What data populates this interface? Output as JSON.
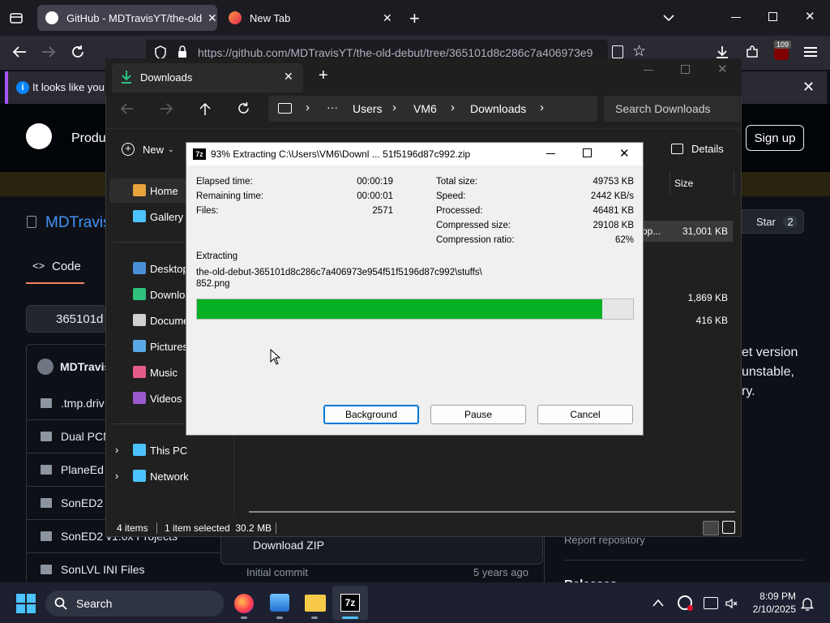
{
  "browser": {
    "tabs": [
      {
        "label": "GitHub - MDTravisYT/the-old-d",
        "active": true
      },
      {
        "label": "New Tab",
        "active": false
      }
    ],
    "url": "https://github.com/MDTravisYT/the-old-debut/tree/365101d8c286c7a406973e9",
    "notification_badge": "109",
    "notice_text": "It looks like you h"
  },
  "github": {
    "nav_label": "Produ",
    "signup_label": "Sign up",
    "repo_name": "MDTravis",
    "code_tab": "Code",
    "branch": "365101d",
    "star_label": "Star",
    "star_count": "2",
    "owner_label": "MDTravis",
    "files": [
      ".tmp.driv",
      "Dual PCM",
      "PlaneEd I",
      "SonED2 I",
      "SonED2 v1.0x Projects",
      "SonLVL INI Files"
    ],
    "download_zip": "Download ZIP",
    "commit_msg": "Initial commit",
    "commit_age": "5 years ago",
    "about_lines": [
      "et version",
      "unstable,",
      "ry."
    ],
    "report_repository": "Report repository",
    "releases": "Releases"
  },
  "explorer": {
    "title": "Downloads",
    "breadcrumb": [
      "Users",
      "VM6",
      "Downloads"
    ],
    "search_placeholder": "Search Downloads",
    "new_label": "New",
    "details_label": "Details",
    "size_header": "Size",
    "nav_items": [
      {
        "label": "Home",
        "icon": "home-icon"
      },
      {
        "label": "Gallery",
        "icon": "gallery-icon"
      },
      {
        "label": "Desktop",
        "icon": "desktop-icon"
      },
      {
        "label": "Downloa",
        "icon": "download-icon"
      },
      {
        "label": "Docume",
        "icon": "document-icon"
      },
      {
        "label": "Pictures",
        "icon": "pictures-icon"
      },
      {
        "label": "Music",
        "icon": "music-icon"
      },
      {
        "label": "Videos",
        "icon": "videos-icon"
      },
      {
        "label": "This PC",
        "icon": "pc-icon"
      },
      {
        "label": "Network",
        "icon": "network-icon"
      }
    ],
    "file_rows": [
      {
        "name": "pp...",
        "size": "31,001 KB"
      },
      {
        "name": "",
        "size": "1,869 KB"
      },
      {
        "name": "",
        "size": "416 KB"
      }
    ],
    "status_items": "4 items",
    "status_selected": "1 item selected  30.2 MB"
  },
  "sevenzip": {
    "title": "93% Extracting C:\\Users\\VM6\\Downl ... 51f5196d87c992.zip",
    "stats_left": [
      {
        "label": "Elapsed time:",
        "value": "00:00:19"
      },
      {
        "label": "Remaining time:",
        "value": "00:00:01"
      },
      {
        "label": "Files:",
        "value": "2571"
      }
    ],
    "stats_right": [
      {
        "label": "Total size:",
        "value": "49753 KB"
      },
      {
        "label": "Speed:",
        "value": "2442 KB/s"
      },
      {
        "label": "Processed:",
        "value": "46481 KB"
      },
      {
        "label": "Compressed size:",
        "value": "29108 KB"
      },
      {
        "label": "Compression ratio:",
        "value": "62%"
      }
    ],
    "operation": "Extracting",
    "current_file_line1": "the-old-debut-365101d8c286c7a406973e954f51f5196d87c992\\stuffs\\",
    "current_file_line2": "852.png",
    "progress": 0.93,
    "buttons": {
      "background": "Background",
      "pause": "Pause",
      "cancel": "Cancel"
    }
  },
  "taskbar": {
    "search_label": "Search",
    "time": "8:09 PM",
    "date": "2/10/2025"
  },
  "colors": {
    "progress_green": "#06b025",
    "github_bg": "#0d1117",
    "explorer_bg": "#202020",
    "taskbar_bg": "#1c2030",
    "accent_blue": "#0078d4"
  }
}
